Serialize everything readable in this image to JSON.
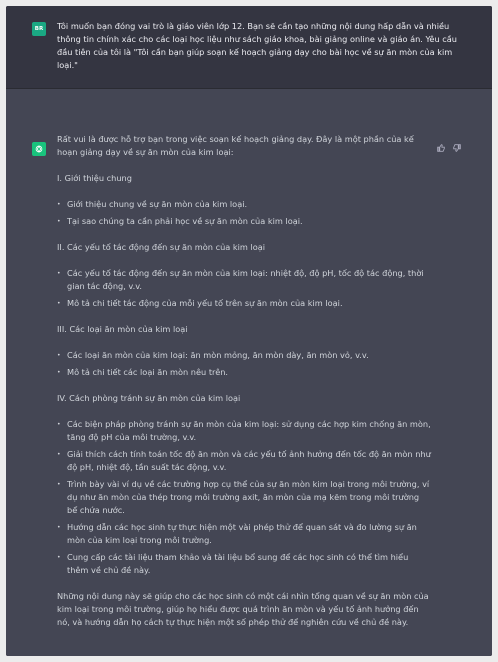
{
  "user": {
    "avatar_text": "BR",
    "message": "Tôi muốn bạn đóng vai trò là giáo viên lớp 12. Bạn sẽ cần tạo những nội dung hấp dẫn và nhiều thông tin chính xác cho các loại học liệu như sách giáo khoa, bài giảng online và giáo án. Yêu cầu đầu tiên của tôi là \"Tôi cần bạn giúp soạn kế hoạch giảng dạy cho bài học về sự ăn mòn của kim loại.\""
  },
  "assistant": {
    "intro": "Rất vui là được hỗ trợ bạn trong việc soạn kế hoạch giảng dạy. Đây là một phần của kế hoạn giảng dạy về sự ăn mòn của kim loại:",
    "sections": [
      {
        "title": "I. Giới thiệu chung",
        "items": [
          "Giới thiệu chung về sự ăn mòn của kim loại.",
          "Tại sao chúng ta cần phải học về sự ăn mòn của kim loại."
        ]
      },
      {
        "title": "II. Các yếu tố tác động đến sự ăn mòn của kim loại",
        "items": [
          "Các yếu tố tác động đến sự ăn mòn của kim loại: nhiệt độ, độ pH, tốc độ tác động, thời gian tác động, v.v.",
          "Mô tả chi tiết tác động của mỗi yếu tố trên sự ăn mòn của kim loại."
        ]
      },
      {
        "title": "III. Các loại ăn mòn của kim loại",
        "items": [
          "Các loại ăn mòn của kim loại: ăn mòn mỏng, ăn mòn dày, ăn mòn vỏ, v.v.",
          "Mô tả chi tiết các loại ăn mòn nêu trên."
        ]
      },
      {
        "title": "IV. Cách phòng tránh sự ăn mòn của kim loại",
        "items": [
          "Các biện pháp phòng tránh sự ăn mòn của kim loại: sử dụng các hợp kim chống ăn mòn, tăng độ pH của môi trường, v.v.",
          "Giải thích cách tính toán tốc độ ăn mòn và các yếu tố ảnh hưởng đến tốc độ ăn mòn như độ pH, nhiệt độ, tần suất tác động, v.v.",
          "Trình bày vài ví dụ về các trường hợp cụ thể của sự ăn mòn kim loại trong môi trường, ví dụ như ăn mòn của thép trong môi trường axit, ăn mòn của mạ kẽm trong môi trường bể chứa nước.",
          "Hướng dẫn các học sinh tự thực hiện một vài phép thử để quan sát và đo lường sự ăn mòn của kim loại trong môi trường.",
          "Cung cấp các tài liệu tham khảo và tài liệu bổ sung để các học sinh có thể tìm hiểu thêm về chủ đề này."
        ]
      }
    ],
    "conclusion": "Những nội dung này sẽ giúp cho các học sinh có một cái nhìn tổng quan về sự ăn mòn của kim loại trong môi trường, giúp họ hiểu được quá trình ăn mòn và yếu tố ảnh hưởng đến nó, và hướng dẫn họ cách tự thực hiện một số phép thử để nghiên cứu về chủ đề này."
  },
  "icons": {
    "user_avatar": "user-avatar-icon",
    "assistant_avatar": "openai-logo-icon",
    "like": "thumbs-up-icon",
    "dislike": "thumbs-down-icon"
  },
  "colors": {
    "page_bg": "#ececec",
    "user_bg": "#343541",
    "assistant_bg": "#444654",
    "user_avatar": "#1aa883",
    "assistant_avatar": "#19c37d",
    "text": "#d1d5db"
  }
}
